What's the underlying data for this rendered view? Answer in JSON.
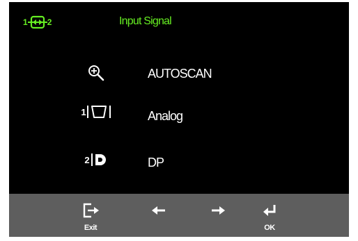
{
  "header": {
    "icon": "input-source-icon",
    "icon_left_num": "1",
    "icon_right_num": "2",
    "title": "Input Signal",
    "accent_color": "#66ee22"
  },
  "menu": [
    {
      "icon": "magnifier-icon",
      "num": "",
      "label": "AUTOSCAN"
    },
    {
      "icon": "analog-port-icon",
      "num": "1",
      "label": "Analog"
    },
    {
      "icon": "displayport-icon",
      "num": "2",
      "label": "DP"
    }
  ],
  "bottom_bar": {
    "buttons": [
      {
        "icon": "exit-icon",
        "label": "Exit"
      },
      {
        "icon": "arrow-left-icon",
        "label": ""
      },
      {
        "icon": "arrow-right-icon",
        "label": ""
      },
      {
        "icon": "enter-icon",
        "label": "OK"
      }
    ]
  }
}
